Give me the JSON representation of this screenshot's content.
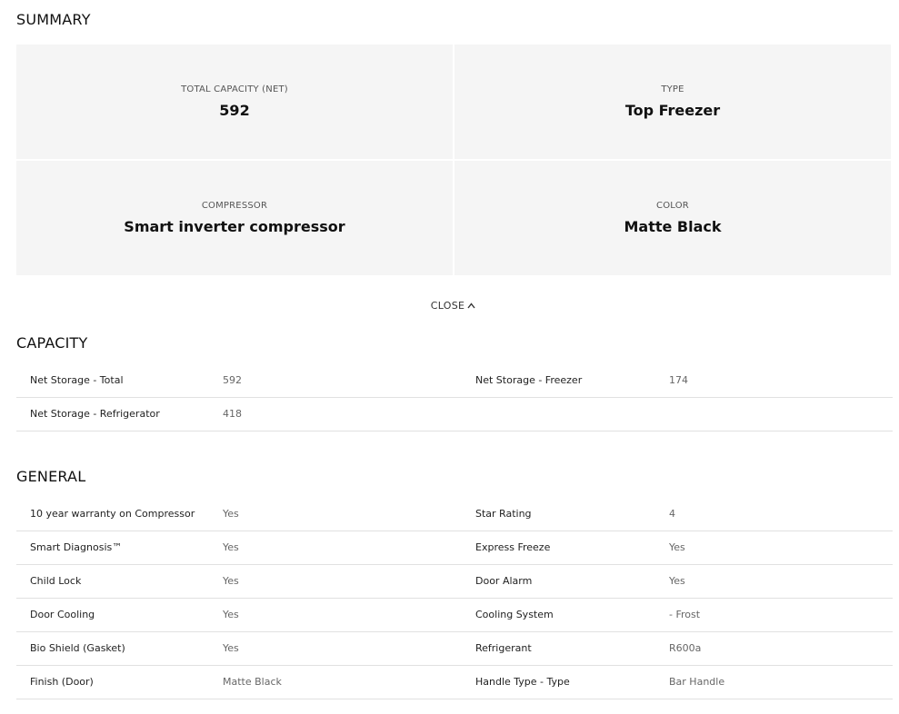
{
  "summary": {
    "title": "SUMMARY",
    "cells": [
      {
        "label": "TOTAL CAPACITY (NET)",
        "value": "592"
      },
      {
        "label": "TYPE",
        "value": "Top Freezer"
      },
      {
        "label": "COMPRESSOR",
        "value": "Smart inverter compressor"
      },
      {
        "label": "COLOR",
        "value": "Matte Black"
      }
    ]
  },
  "toggle": {
    "label": "CLOSE",
    "icon": "chevron-up-icon"
  },
  "capacity": {
    "title": "CAPACITY",
    "rows": [
      {
        "k1": "Net Storage - Total",
        "v1": "592",
        "k2": "Net Storage - Freezer",
        "v2": "174"
      },
      {
        "k1": "Net Storage - Refrigerator",
        "v1": "418",
        "k2": "",
        "v2": ""
      }
    ]
  },
  "general": {
    "title": "GENERAL",
    "rows": [
      {
        "k1": "10 year warranty on Compressor",
        "v1": "Yes",
        "k2": "Star Rating",
        "v2": "4"
      },
      {
        "k1": "Smart Diagnosis™",
        "v1": "Yes",
        "k2": "Express Freeze",
        "v2": "Yes"
      },
      {
        "k1": "Child Lock",
        "v1": "Yes",
        "k2": "Door Alarm",
        "v2": "Yes"
      },
      {
        "k1": "Door Cooling",
        "v1": "Yes",
        "k2": "Cooling System",
        "v2": "- Frost"
      },
      {
        "k1": "Bio Shield (Gasket)",
        "v1": "Yes",
        "k2": "Refrigerant",
        "v2": "R600a"
      },
      {
        "k1": "Finish (Door)",
        "v1": "Matte Black",
        "k2": "Handle Type - Type",
        "v2": "Bar Handle"
      }
    ]
  }
}
